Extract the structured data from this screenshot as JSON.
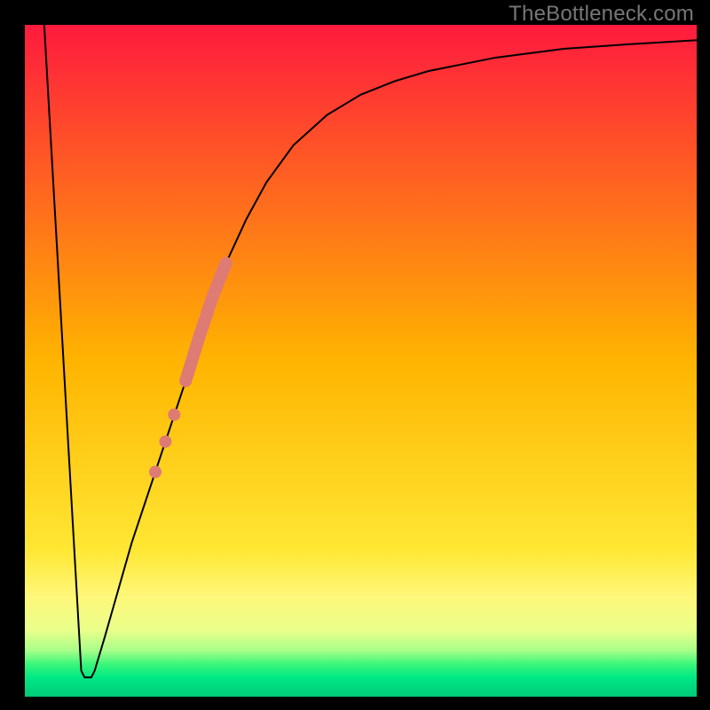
{
  "watermark": "TheBottleneck.com",
  "chart_data": {
    "type": "line",
    "title": "",
    "xlabel": "",
    "ylabel": "",
    "xlim": [
      0,
      100
    ],
    "ylim": [
      0,
      100
    ],
    "background_gradient": {
      "stops": [
        {
          "offset": 0.0,
          "color": "#ff1a3e"
        },
        {
          "offset": 0.5,
          "color": "#ffb400"
        },
        {
          "offset": 0.78,
          "color": "#ffe733"
        },
        {
          "offset": 0.85,
          "color": "#fff77a"
        },
        {
          "offset": 0.9,
          "color": "#e9ff8a"
        },
        {
          "offset": 0.93,
          "color": "#a8ff8a"
        },
        {
          "offset": 0.95,
          "color": "#3cf77a"
        },
        {
          "offset": 0.97,
          "color": "#00e884"
        },
        {
          "offset": 1.0,
          "color": "#00c878"
        }
      ]
    },
    "series": [
      {
        "name": "curve",
        "stroke": "#000000",
        "stroke_width": 2,
        "points": [
          {
            "x": 3.0,
            "y": 100.0
          },
          {
            "x": 8.5,
            "y": 4.0
          },
          {
            "x": 9.0,
            "y": 3.0
          },
          {
            "x": 10.0,
            "y": 3.0
          },
          {
            "x": 10.5,
            "y": 4.0
          },
          {
            "x": 12.0,
            "y": 9.0
          },
          {
            "x": 14.0,
            "y": 16.0
          },
          {
            "x": 16.0,
            "y": 23.0
          },
          {
            "x": 18.0,
            "y": 29.0
          },
          {
            "x": 20.0,
            "y": 35.0
          },
          {
            "x": 22.0,
            "y": 41.0
          },
          {
            "x": 24.0,
            "y": 47.0
          },
          {
            "x": 26.0,
            "y": 53.5
          },
          {
            "x": 28.0,
            "y": 59.5
          },
          {
            "x": 30.0,
            "y": 64.5
          },
          {
            "x": 33.0,
            "y": 71.0
          },
          {
            "x": 36.0,
            "y": 76.5
          },
          {
            "x": 40.0,
            "y": 82.0
          },
          {
            "x": 45.0,
            "y": 86.5
          },
          {
            "x": 50.0,
            "y": 89.5
          },
          {
            "x": 55.0,
            "y": 91.5
          },
          {
            "x": 60.0,
            "y": 93.0
          },
          {
            "x": 70.0,
            "y": 95.0
          },
          {
            "x": 80.0,
            "y": 96.3
          },
          {
            "x": 90.0,
            "y": 97.0
          },
          {
            "x": 100.0,
            "y": 97.6
          }
        ]
      }
    ],
    "highlight_band": {
      "color": "#dd7b74",
      "width": 14,
      "x_start": 24.0,
      "x_end": 30.0
    },
    "highlight_dots": {
      "color": "#dd7b74",
      "radius": 7,
      "points": [
        {
          "x": 22.3,
          "y": 42.0
        },
        {
          "x": 21.0,
          "y": 38.0
        },
        {
          "x": 19.5,
          "y": 33.5
        }
      ]
    },
    "frame": {
      "inset_left": 27,
      "inset_right": 14,
      "inset_top": 27,
      "inset_bottom": 14,
      "stroke": "#000000"
    }
  }
}
